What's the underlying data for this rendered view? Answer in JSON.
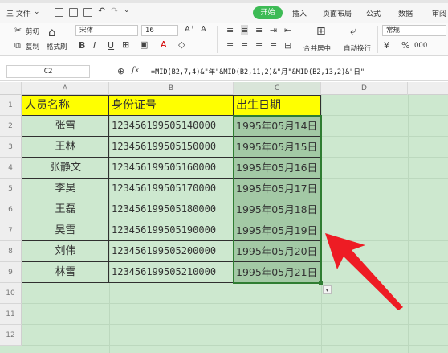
{
  "menu": {
    "file_label": "三 文件",
    "chevron": "⌄",
    "tabs": [
      "开始",
      "插入",
      "页面布局",
      "公式",
      "数据",
      "审阅"
    ]
  },
  "ribbon": {
    "cut": "剪切",
    "copy": "复制",
    "format_painter": "格式刷",
    "paste": "粘贴",
    "font_name": "宋体",
    "font_size": "16",
    "grow_font": "A⁺",
    "shrink_font": "A⁻",
    "bold": "B",
    "italic": "I",
    "underline": "U",
    "merge_center": "合并居中",
    "wrap_text": "自动换行",
    "number_format": "常规",
    "percent": "%",
    "thousands": "000"
  },
  "formula_bar": {
    "cell_ref": "C2",
    "fx": "fx",
    "formula": "=MID(B2,7,4)&\"年\"&MID(B2,11,2)&\"月\"&MID(B2,13,2)&\"日\""
  },
  "columns": [
    "A",
    "B",
    "C",
    "D"
  ],
  "row_numbers": [
    "1",
    "2",
    "3",
    "4",
    "5",
    "6",
    "7",
    "8",
    "9",
    "10",
    "11",
    "12"
  ],
  "headers": [
    "人员名称",
    "身份证号",
    "出生日期"
  ],
  "rows": [
    [
      "张雪",
      "123456199505140000",
      "1995年05月14日"
    ],
    [
      "王林",
      "123456199505150000",
      "1995年05月15日"
    ],
    [
      "张静文",
      "123456199505160000",
      "1995年05月16日"
    ],
    [
      "李昊",
      "123456199505170000",
      "1995年05月17日"
    ],
    [
      "王磊",
      "123456199505180000",
      "1995年05月18日"
    ],
    [
      "吴雪",
      "123456199505190000",
      "1995年05月19日"
    ],
    [
      "刘伟",
      "123456199505200000",
      "1995年05月20日"
    ],
    [
      "林雪",
      "123456199505210000",
      "1995年05月21日"
    ]
  ],
  "colors": {
    "header_fill": "#ffff00",
    "selected_fill": "#a3c9a5",
    "grid_bg": "#cde8cf",
    "arrow": "#ee1c24",
    "accent": "#3dbb55"
  }
}
